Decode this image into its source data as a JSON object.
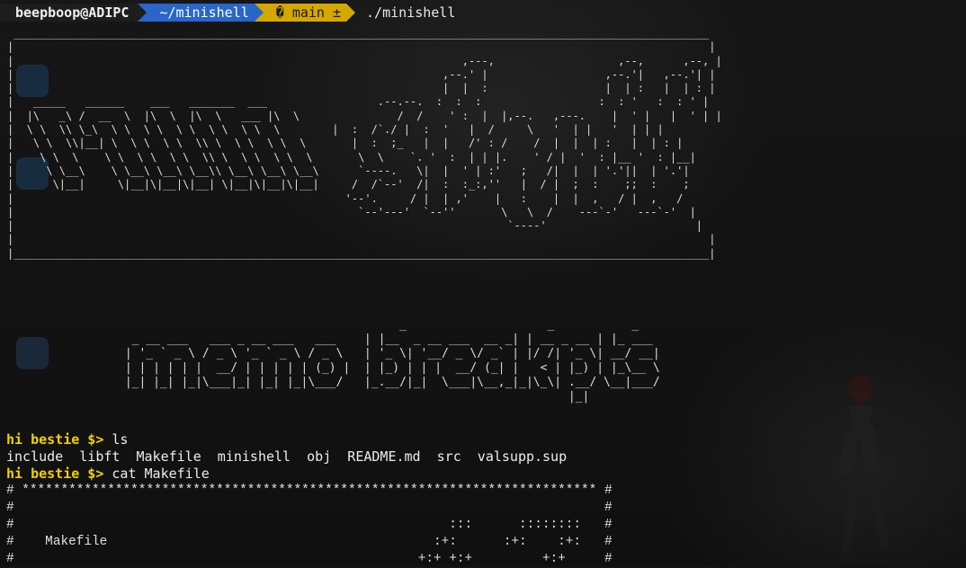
{
  "prompt": {
    "user_host": "beepboop@ADIPC",
    "directory": "~/minishell",
    "git_branch": "� main ±",
    "command": "./minishell"
  },
  "banner": {
    "box_art": " ___________________________________________________________________________________________________________\n|                                                                                                           |\n|                                                                     ,---,                   ,--,      ,--, |\n|                                                                  ,--.' |                  ,--.'|   ,--.'| |\n|                                                                  |  |  :                  |  | :   |  | : |\n|   _____   ______    ___   _______  ___                 .--.--.  :  :  :                  :  : '   :  : ' |\n|  |\\   _\\ /  __  \\  |\\  \\  |\\  \\   ___ |\\  \\               /  /    ' :  |  |,--.   ,---.    |  ' |   |  ' | |\n|  \\ \\  \\\\ \\_\\  \\ \\  \\ \\  \\ \\  \\ \\  \\ \\  \\        |  :  /`./ |  :  '   |  /     \\   '  | |   '  | | |\n|   \\ \\  \\\\|__| \\  \\ \\  \\ \\  \\\\ \\  \\ \\  \\ \\  \\       |  :  ;_   |  |   /' : /    /  |  |  | :   |  | : |\n|    \\ \\  \\    \\ \\  \\ \\  \\ \\  \\\\ \\  \\ \\  \\ \\  \\       \\  \\    `. '  :  | | |.    ' / |  '  : |__ '  : |__|\n|     \\ \\__\\    \\ \\__\\ \\__\\ \\__\\\\ \\__\\ \\__\\ \\__\\      `----.   \\|  |  ' | :'   ;   /|  |  | '.'||  | '.'|\n|      \\|__|     \\|__|\\|__|\\|__| \\|__|\\|__|\\|__|     /  /`--'  /|  :  :_:,''   |  / |  ;  :    ;;  :    ;\n|                                                   '--'.     / |  | ,'    |   :    |  |  ,   / |  ,   / \n|                                                     `--'---'  `--''       \\   \\  /    ---`-'   ---`-'  |\n|                                                                            `----'                       |\n|                                                                                                           |\n|___________________________________________________________________________________________________________|",
    "logo_art": "                                        _                    _           _\n  _ __ ___   ___ _ __ ___   ___    | |__  _ __ ___  __ _| | __ _ __ | |_ ___\n | '_ ` _ \\ / _ \\ '_ ` _ \\ / _ \\   | '_ \\| '__/ _ \\/ _` | |/ /| '_ \\| __/ __|\n | | | | | |  __/ | | | | | (_) |  | |_) | | |  __/ (_| |   < | |_) | |_\\__ \\\n |_| |_| |_|\\___|_| |_| |_|\\___/   |_.__/|_|  \\___|\\__,_|_|\\_\\| .__/ \\__|___/\n                                                                |_|"
  },
  "session": {
    "ps1_1": "hi bestie $>",
    "cmd_1": "ls",
    "ls_output": "include  libft  Makefile  minishell  obj  README.md  src  valsupp.sup",
    "ps1_2": "hi bestie $>",
    "cmd_2": "cat Makefile"
  },
  "makefile_head": "# ************************************************************************** #\n#                                                                            #\n#                                                        :::      ::::::::   #\n#    Makefile                                          :+:      :+:    :+:   #\n#                                                    +:+ +:+         +:+     #"
}
